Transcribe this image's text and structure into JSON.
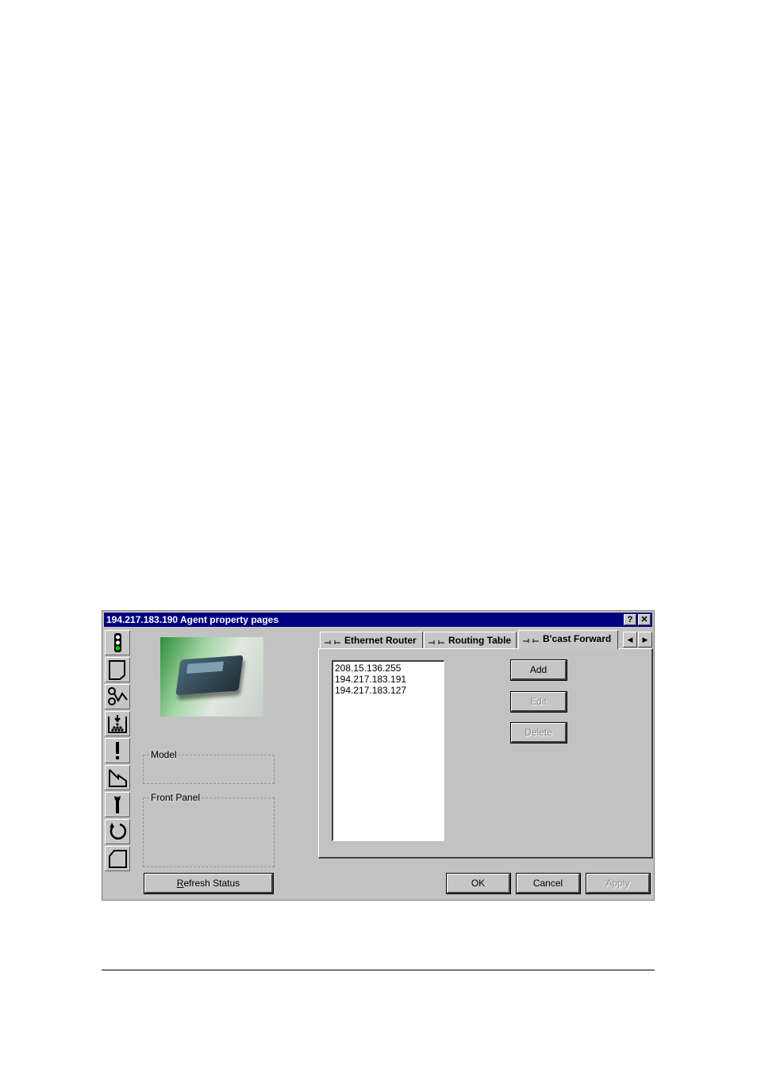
{
  "window": {
    "title": "194.217.183.190 Agent property pages",
    "help_label": "?",
    "close_label": "✕"
  },
  "sidebar_icons": [
    "traffic-light-icon",
    "page-icon",
    "network-wave-icon",
    "download-queue-icon",
    "alert-icon",
    "folder-step-icon",
    "wrench-icon",
    "refresh-icon",
    "folded-page-icon"
  ],
  "left_panel": {
    "model_label": "Model",
    "front_panel_label": "Front Panel",
    "refresh_button": {
      "prefix": "R",
      "rest": "efresh Status"
    }
  },
  "tabs": [
    {
      "label": "Ethernet Router",
      "active": false
    },
    {
      "label": "Routing Table",
      "active": false
    },
    {
      "label": "B'cast Forward",
      "active": true
    }
  ],
  "broadcast_list": [
    "208.15.136.255",
    "194.217.183.191",
    "194.217.183.127"
  ],
  "actions": {
    "add_label": "Add",
    "edit_label": "Edit",
    "delete_label": "Delete"
  },
  "footer": {
    "ok_label": "OK",
    "cancel_label": "Cancel",
    "apply_label": "Apply"
  },
  "colors": {
    "titlebar": "#000080",
    "face": "#c6c6c6"
  }
}
